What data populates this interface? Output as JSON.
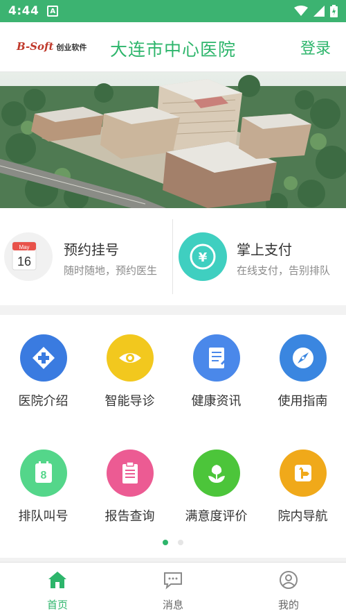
{
  "status_bar": {
    "time": "4:44",
    "a_badge": "A"
  },
  "header": {
    "logo_mark": "B-Soft",
    "logo_text": "创业软件",
    "title": "大连市中心医院",
    "login_label": "登录"
  },
  "quick_actions": [
    {
      "title": "预约挂号",
      "subtitle": "随时随地，预约医生",
      "icon": "calendar-icon",
      "calendar_month": "May",
      "calendar_day": "16"
    },
    {
      "title": "掌上支付",
      "subtitle": "在线支付，告别排队",
      "icon": "yuan-icon",
      "symbol": "¥"
    }
  ],
  "grid": [
    {
      "label": "医院介绍",
      "icon": "hospital-cross-icon",
      "color": "#3a7be0"
    },
    {
      "label": "智能导诊",
      "icon": "eye-icon",
      "color": "#f2c81e"
    },
    {
      "label": "健康资讯",
      "icon": "document-icon",
      "color": "#4a88ea"
    },
    {
      "label": "使用指南",
      "icon": "compass-icon",
      "color": "#3a86e0"
    },
    {
      "label": "排队叫号",
      "icon": "queue-number-icon",
      "color": "#54d68a",
      "number": "8"
    },
    {
      "label": "报告查询",
      "icon": "clipboard-icon",
      "color": "#ec5b93"
    },
    {
      "label": "满意度评价",
      "icon": "flower-icon",
      "color": "#4cc53a"
    },
    {
      "label": "院内导航",
      "icon": "signpost-icon",
      "color": "#f0a91a"
    }
  ],
  "pager": {
    "current": 1,
    "total": 2
  },
  "bottom_nav": [
    {
      "label": "首页",
      "icon": "home-icon",
      "active": true
    },
    {
      "label": "消息",
      "icon": "message-icon",
      "active": false
    },
    {
      "label": "我的",
      "icon": "profile-icon",
      "active": false
    }
  ],
  "colors": {
    "brand_green": "#2db56b",
    "status_bar": "#3cb371"
  }
}
